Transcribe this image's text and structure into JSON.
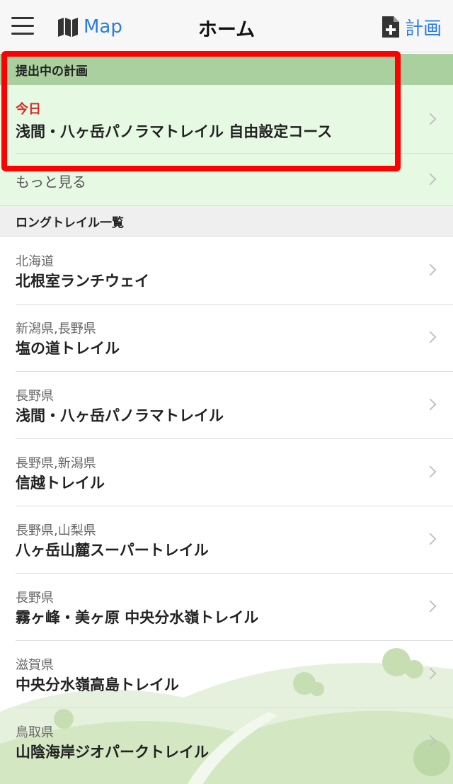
{
  "navbar": {
    "menu_icon": "hamburger-menu-icon",
    "map_label": "Map",
    "map_icon": "folded-map-icon",
    "title": "ホーム",
    "plan_label": "計画",
    "plan_icon": "add-document-icon"
  },
  "plans_section": {
    "header": "提出中の計画",
    "items": [
      {
        "date": "今日",
        "name": "浅間・八ヶ岳パノラマトレイル 自由設定コース"
      }
    ],
    "more_label": "もっと見る"
  },
  "trails_section": {
    "header": "ロングトレイル一覧",
    "items": [
      {
        "prefecture": "北海道",
        "name": "北根室ランチウェイ"
      },
      {
        "prefecture": "新潟県,長野県",
        "name": "塩の道トレイル"
      },
      {
        "prefecture": "長野県",
        "name": "浅間・八ヶ岳パノラマトレイル"
      },
      {
        "prefecture": "長野県,新潟県",
        "name": "信越トレイル"
      },
      {
        "prefecture": "長野県,山梨県",
        "name": "八ヶ岳山麓スーパートレイル"
      },
      {
        "prefecture": "長野県",
        "name": "霧ヶ峰・美ヶ原 中央分水嶺トレイル"
      },
      {
        "prefecture": "滋賀県",
        "name": "中央分水嶺高島トレイル"
      },
      {
        "prefecture": "鳥取県",
        "name": "山陰海岸ジオパークトレイル"
      }
    ]
  },
  "colors": {
    "accent": "#2b7de0",
    "plans_header_bg": "#abd0a0",
    "plans_bg": "#e6f9e3",
    "date_red": "#d22d2d",
    "highlight_red": "#ff0000"
  }
}
